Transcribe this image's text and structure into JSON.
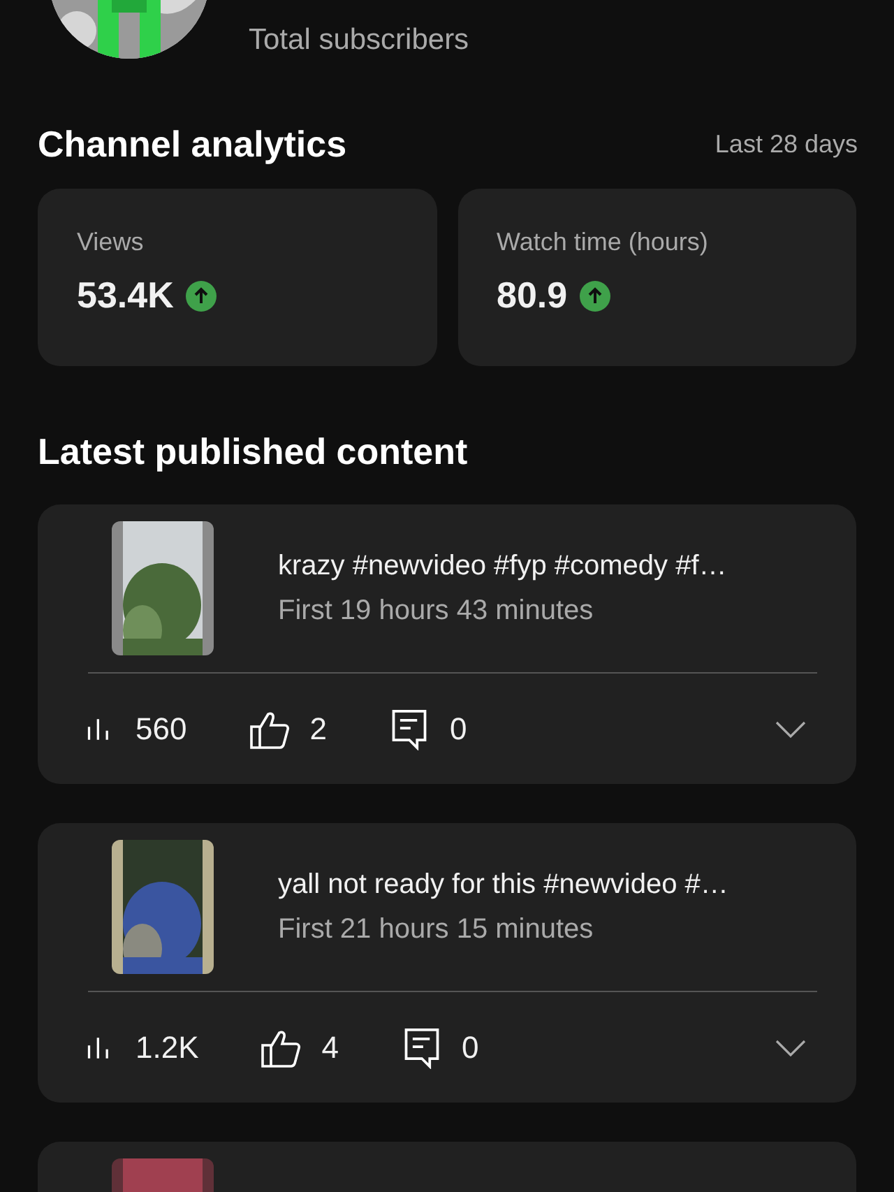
{
  "header": {
    "subscribers_label": "Total subscribers"
  },
  "analytics": {
    "title": "Channel analytics",
    "period": "Last 28 days",
    "metrics": [
      {
        "label": "Views",
        "value": "53.4K",
        "rising": true
      },
      {
        "label": "Watch time (hours)",
        "value": "80.9",
        "rising": true
      }
    ]
  },
  "latest": {
    "title": "Latest published content",
    "videos": [
      {
        "thumbnail": {
          "kind": "picture"
        },
        "title": "krazy #newvideo #fyp #comedy #f…",
        "subtitle": "First 19 hours 43 minutes",
        "views": "560",
        "likes": "2",
        "comments": "0"
      },
      {
        "thumbnail": {
          "kind": "picture"
        },
        "title": "yall not ready for this #newvideo #…",
        "subtitle": "First 21 hours 15 minutes",
        "views": "1.2K",
        "likes": "4",
        "comments": "0"
      },
      {
        "thumbnail": {
          "kind": "picture"
        }
      }
    ]
  }
}
